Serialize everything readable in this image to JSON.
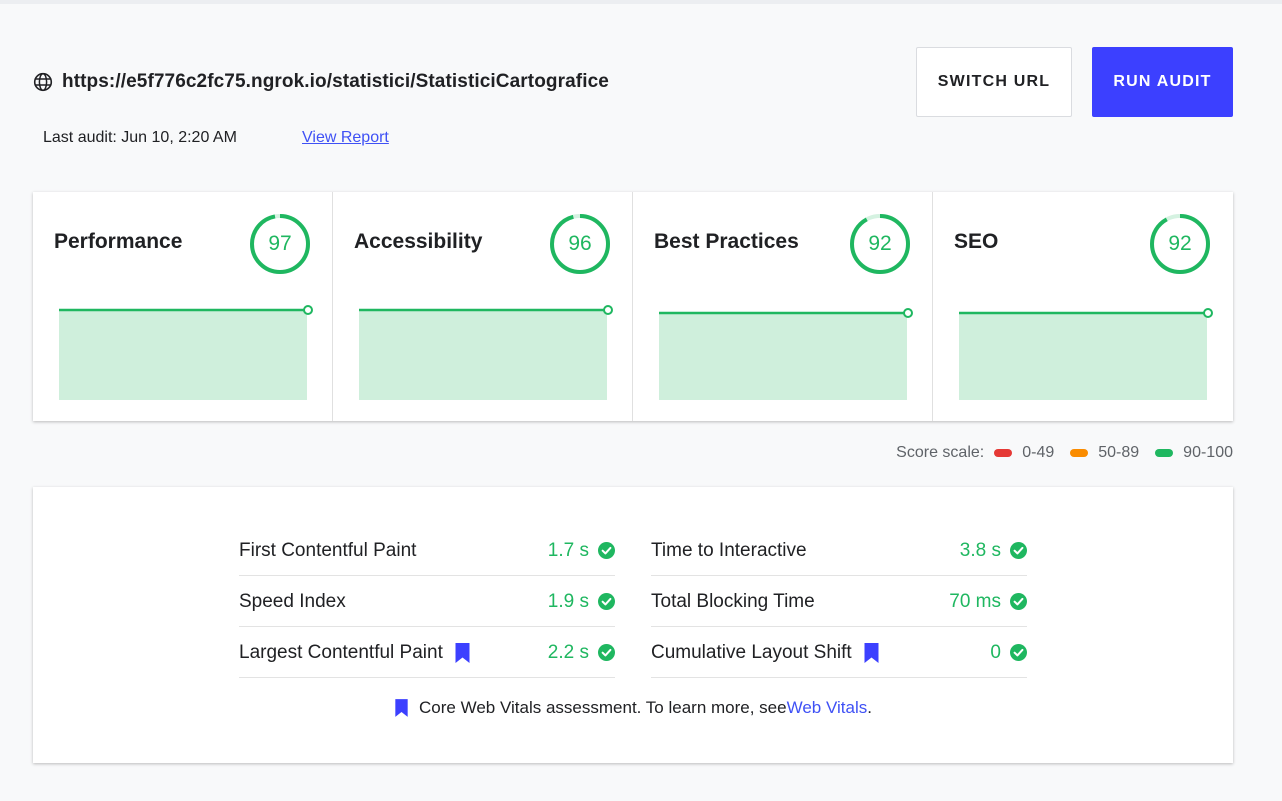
{
  "header": {
    "url": "https://e5f776c2fc75.ngrok.io/statistici/StatisticiCartografice",
    "last_audit": "Last audit: Jun 10, 2:20 AM",
    "view_report": "View Report",
    "switch_url": "SWITCH URL",
    "run_audit": "RUN AUDIT",
    "icon": "globe-icon"
  },
  "colors": {
    "accent": "#3c40ff",
    "good": "#1fb760",
    "average": "#fa8c00",
    "poor": "#e53935",
    "trend_fill": "#cfefdc"
  },
  "scores": [
    {
      "name": "Performance",
      "score": "97",
      "value": 97
    },
    {
      "name": "Accessibility",
      "score": "96",
      "value": 96
    },
    {
      "name": "Best Practices",
      "score": "92",
      "value": 92
    },
    {
      "name": "SEO",
      "score": "92",
      "value": 92
    }
  ],
  "scale": {
    "label": "Score scale:",
    "ranges": [
      "0-49",
      "50-89",
      "90-100"
    ]
  },
  "metrics": {
    "left": [
      {
        "name": "First Contentful Paint",
        "value": "1.7 s",
        "core": false
      },
      {
        "name": "Speed Index",
        "value": "1.9 s",
        "core": false
      },
      {
        "name": "Largest Contentful Paint",
        "value": "2.2 s",
        "core": true
      }
    ],
    "right": [
      {
        "name": "Time to Interactive",
        "value": "3.8 s",
        "core": false
      },
      {
        "name": "Total Blocking Time",
        "value": "70 ms",
        "core": false
      },
      {
        "name": "Cumulative Layout Shift",
        "value": "0",
        "core": true
      }
    ],
    "footnote_text": "Core Web Vitals assessment. To learn more, see ",
    "footnote_link": "Web Vitals",
    "footnote_end": "."
  }
}
